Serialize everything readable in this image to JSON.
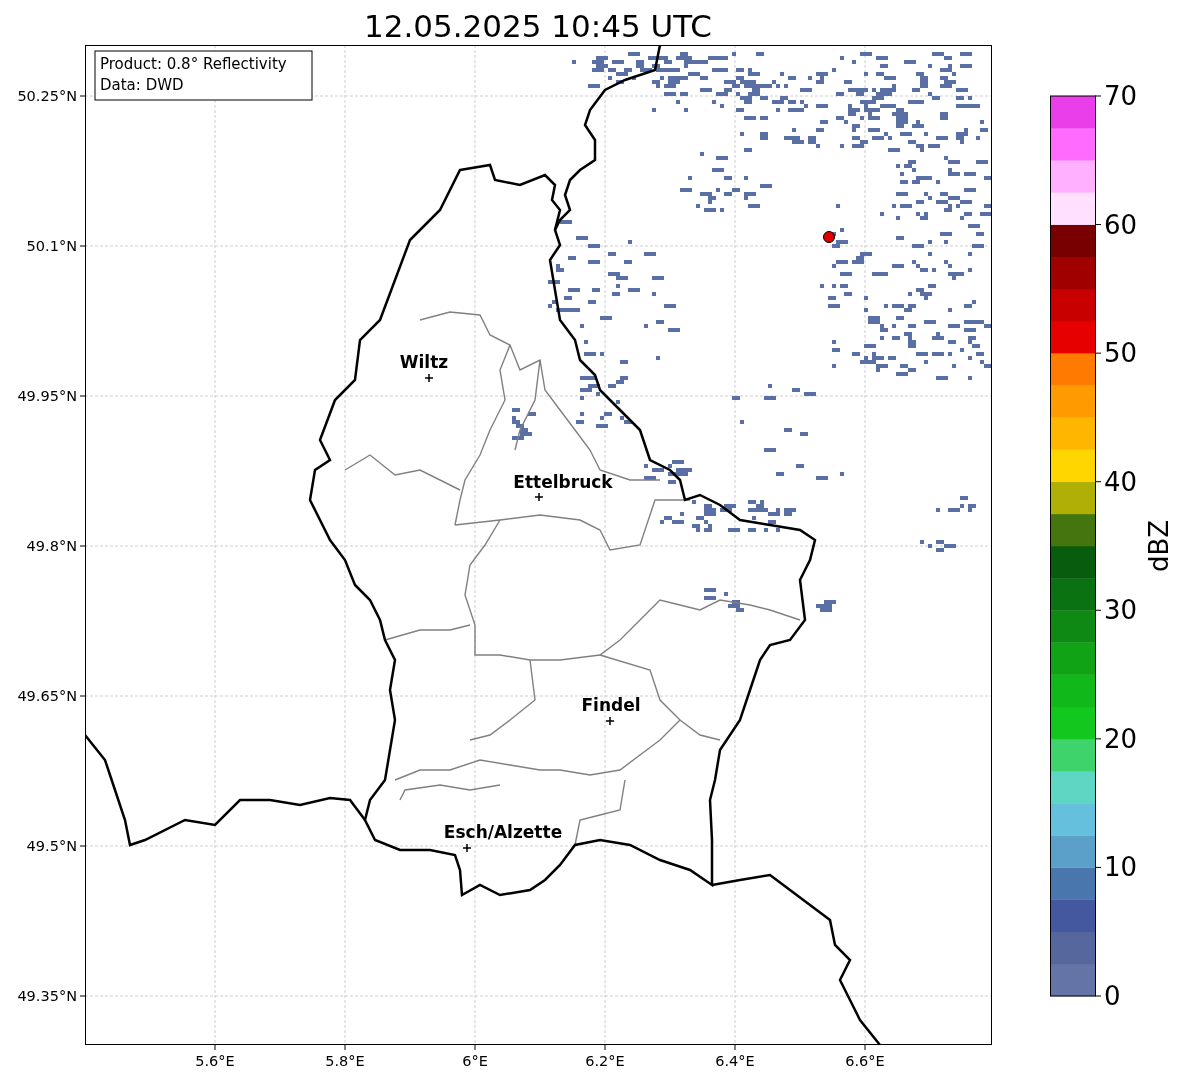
{
  "title": "12.05.2025 10:45 UTC",
  "info_box": [
    "Product: 0.8° Reflectivity",
    "Data: DWD"
  ],
  "latitude_ticks": [
    "50.25°N",
    "50.1°N",
    "49.95°N",
    "49.8°N",
    "49.65°N",
    "49.5°N",
    "49.35°N"
  ],
  "longitude_ticks": [
    "5.6°E",
    "5.8°E",
    "6°E",
    "6.2°E",
    "6.4°E",
    "6.6°E"
  ],
  "cities": [
    {
      "name": "Wiltz"
    },
    {
      "name": "Ettelbruck"
    },
    {
      "name": "Findel"
    },
    {
      "name": "Esch/Alzette"
    }
  ],
  "colorbar": {
    "label": "dBZ",
    "ticks": [
      "70",
      "60",
      "50",
      "40",
      "30",
      "20",
      "10",
      "0"
    ],
    "bins": [
      {
        "color": "#6474a6"
      },
      {
        "color": "#56679e"
      },
      {
        "color": "#43589e"
      },
      {
        "color": "#4a76ae"
      },
      {
        "color": "#5aa0c8"
      },
      {
        "color": "#64c0dc"
      },
      {
        "color": "#5ed6c4"
      },
      {
        "color": "#3ed46b"
      },
      {
        "color": "#12c81e"
      },
      {
        "color": "#10b81a"
      },
      {
        "color": "#0fa315"
      },
      {
        "color": "#0e8a14"
      },
      {
        "color": "#0b7212"
      },
      {
        "color": "#075c0e"
      },
      {
        "color": "#45750f"
      },
      {
        "color": "#afb006"
      },
      {
        "color": "#ffd600"
      },
      {
        "color": "#ffb600"
      },
      {
        "color": "#ff9a00"
      },
      {
        "color": "#ff7a00"
      },
      {
        "color": "#e60000"
      },
      {
        "color": "#c80000"
      },
      {
        "color": "#a00000"
      },
      {
        "color": "#780000"
      },
      {
        "color": "#ffe0ff"
      },
      {
        "color": "#ffb0ff"
      },
      {
        "color": "#ff6bff"
      },
      {
        "color": "#e93ee9"
      }
    ]
  }
}
